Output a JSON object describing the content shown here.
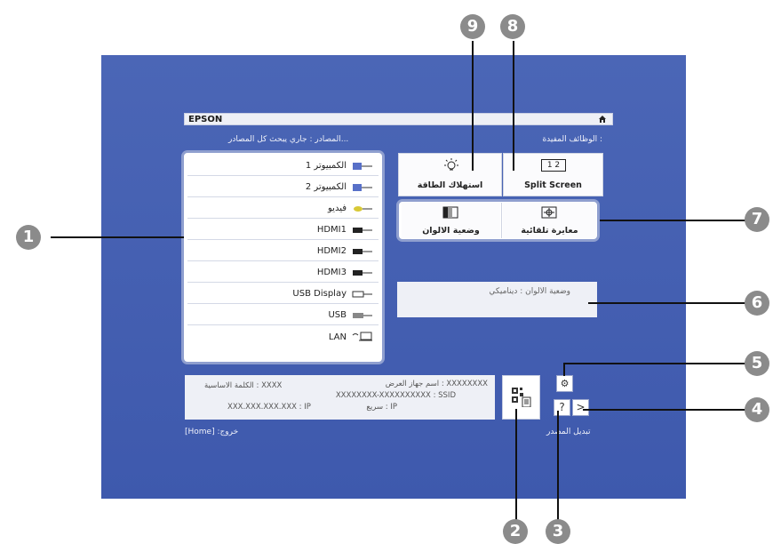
{
  "header": {
    "brand": "EPSON"
  },
  "top_labels": {
    "useful_functions": "الوظائف المفيدة :",
    "sources_status": "المصادر : جاري يبحث كل المصادر..."
  },
  "sources": [
    {
      "label": "الكمبيوتر 1",
      "icon": "vga-port-icon"
    },
    {
      "label": "الكمبيوتر 2",
      "icon": "vga-port-icon"
    },
    {
      "label": "فيديو",
      "icon": "rca-video-icon"
    },
    {
      "label": "HDMI1",
      "icon": "hdmi-port-icon"
    },
    {
      "label": "HDMI2",
      "icon": "hdmi-port-icon"
    },
    {
      "label": "HDMI3",
      "icon": "hdmi-port-icon"
    },
    {
      "label": "USB Display",
      "icon": "usb-display-icon"
    },
    {
      "label": "USB",
      "icon": "usb-port-icon"
    },
    {
      "label": "LAN",
      "icon": "lan-icon"
    }
  ],
  "function_tiles": {
    "power": "استهلاك الطاقة",
    "split": "Split Screen",
    "split_icon_text": "1 2",
    "color_mode": "وضعية الالوان",
    "auto_calib": "معايرة تلقائية"
  },
  "color_mode_status": "وضعية الالوان  :  ديناميكي",
  "network_info": {
    "display_name": "اسم جهاز العرض : XXXXXXXX",
    "ssid": "XXXXXXXX-XXXXXXXXXX : SSID",
    "speed": "سريع : IP",
    "keyword": "الكلمة الاساسية : XXXX",
    "ip": "XXX.XXX.XXX.XXX : IP"
  },
  "bottom": {
    "exit": "[Home] :خروج",
    "change_source": "تبديل المصدر"
  },
  "buttons": {
    "help": "?",
    "next": ">"
  },
  "callouts": [
    "1",
    "2",
    "3",
    "4",
    "5",
    "6",
    "7",
    "8",
    "9"
  ]
}
